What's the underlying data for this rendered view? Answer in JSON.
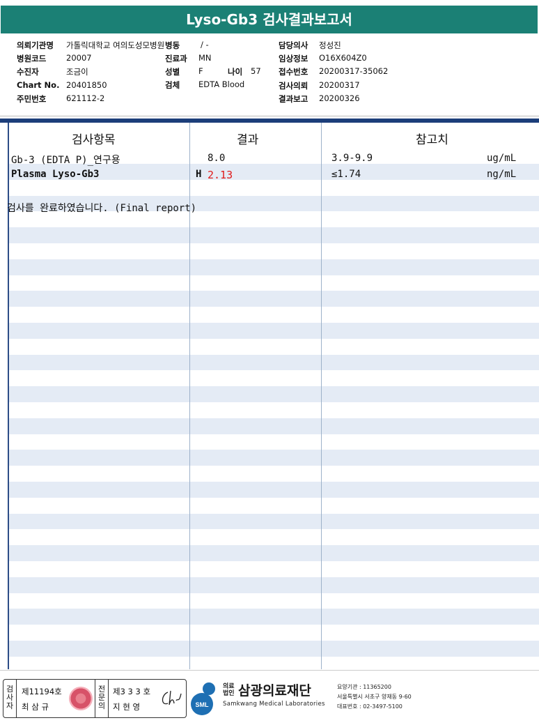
{
  "report": {
    "title": "Lyso-Gb3 검사결과보고서"
  },
  "info": {
    "requesting_org_label": "의뢰기관명",
    "requesting_org": "가톨릭대학교 여의도성모병원",
    "ward_label": "병동",
    "ward": "/ -",
    "doctor_label": "담당의사",
    "doctor": "정성진",
    "hospital_code_label": "병원코드",
    "hospital_code": "20007",
    "department_label": "진료과",
    "department": "MN",
    "clinical_info_label": "임상정보",
    "clinical_info": "O16X604Z0",
    "patient_label": "수진자",
    "patient": "조금이",
    "sex_label": "성별",
    "sex": "F",
    "age_label": "나이",
    "age": "57",
    "receipt_no_label": "접수번호",
    "receipt_no": "20200317-35062",
    "chart_no_label": "Chart No.",
    "chart_no": "20401850",
    "specimen_label": "검체",
    "specimen": "EDTA Blood",
    "test_request_label": "검사의뢰",
    "test_request": "20200317",
    "resident_no_label": "주민번호",
    "resident_no": "621112-2",
    "result_report_label": "결과보고",
    "result_report": "20200326"
  },
  "table": {
    "headers": [
      "검사항목",
      "결과",
      "참고치"
    ],
    "rows": [
      {
        "item": "Gb-3 (EDTA P)_연구용",
        "flag": "",
        "result": "8.0",
        "reference": "3.9-9.9",
        "unit": "ug/mL"
      },
      {
        "item": "Plasma Lyso-Gb3",
        "flag": "H",
        "result": "2.13",
        "reference": "≤1.74",
        "unit": "ng/mL"
      }
    ],
    "note": "검사를  완료하였습니다. (Final report)"
  },
  "footer": {
    "tester_vertical": [
      "검",
      "사",
      "자"
    ],
    "tester_license": "제11194호",
    "tester_name": "최 삼 규",
    "specialist_vertical": [
      "전",
      "문",
      "의"
    ],
    "specialist_license": "제3 3 3 호",
    "specialist_name": "지 현 영",
    "org_type": [
      "의료",
      "법인"
    ],
    "org_name": "삼광의료재단",
    "org_name_en": "Samkwang Medical Laboratories",
    "logo_text": "SML",
    "institution_code": "요양기관 : 11365200",
    "address": "서울특별시 서초구 양재동 9-60",
    "phone": "대표번호 : 02-3497-5100"
  },
  "colors": {
    "title_bg": "#1b8075",
    "divider": "#1c3e7a",
    "stripe": "#e4ebf5",
    "high_flag": "#e01a1a",
    "logo_blue": "#1e6fb3"
  }
}
